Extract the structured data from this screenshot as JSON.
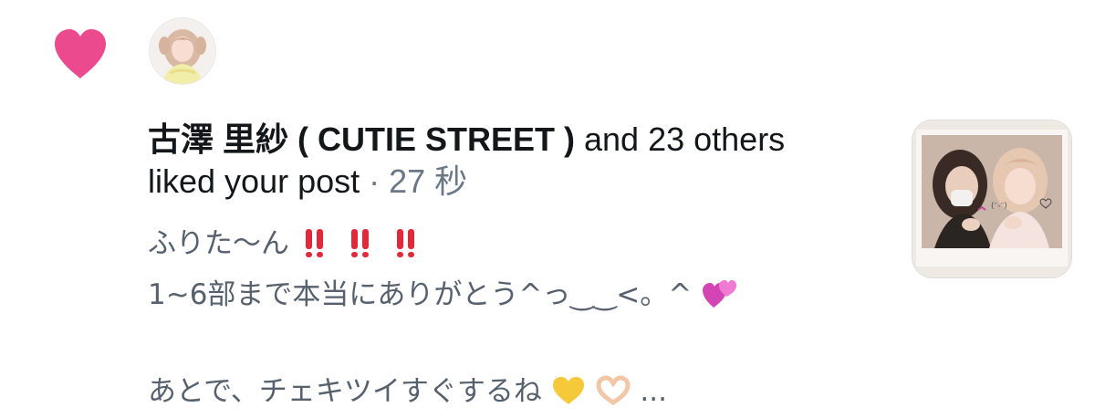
{
  "notification": {
    "type_icon": "heart-icon",
    "accent_color": "#ec4a8e",
    "avatar": "user-avatar",
    "actor_name": "古澤 里紗 ( CUTIE STREET )",
    "others_text": " and 23 others",
    "action_text": "liked your post",
    "separator": " · ",
    "timestamp": "27 秒",
    "post_lines": [
      "ふりた〜ん",
      "1~6部まで本当にありがとう^っ‿‿<。^",
      "",
      "あとで、チェキツイすぐするね"
    ],
    "post_line1_emoji": "double-exclamation-icon ×3",
    "post_line2_emoji": "two-hearts-icon",
    "post_line4_emoji": "yellow-heart-icon, heart-hands-icon",
    "ellipsis": "...",
    "thumbnail": "post-thumbnail-photo"
  }
}
